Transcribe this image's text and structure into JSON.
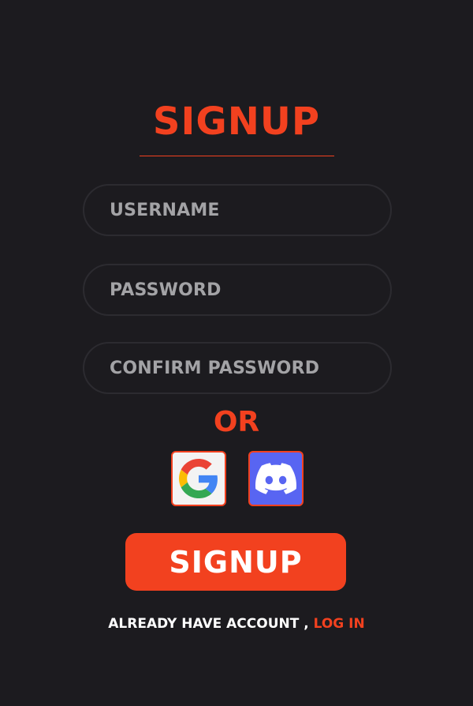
{
  "page": {
    "title": "SIGNUP",
    "accent_color": "#f2411f",
    "background_color": "#1c1b1f"
  },
  "form": {
    "username_placeholder": "USERNAME",
    "username_value": "",
    "password_placeholder": "PASSWORD",
    "password_value": "",
    "confirm_placeholder": "CONFIRM PASSWORD",
    "confirm_value": ""
  },
  "divider_text": "OR",
  "social": {
    "google_icon": "google-icon",
    "discord_icon": "discord-icon"
  },
  "signup_button_label": "SIGNUP",
  "footer": {
    "prompt": "ALREADY HAVE ACCOUNT , ",
    "login_label": "LOG IN"
  }
}
